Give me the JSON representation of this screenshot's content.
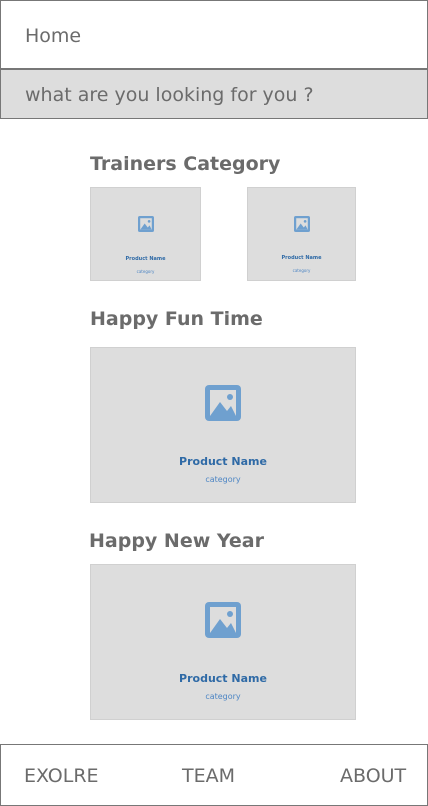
{
  "header": {
    "title": "Home"
  },
  "search": {
    "placeholder": "what are you looking for you ?"
  },
  "sections": [
    {
      "title": "Trainers Category",
      "cards": [
        {
          "name": "Product Name",
          "category": "category",
          "icon": "image-placeholder-icon"
        },
        {
          "name": "Product Name",
          "category": "category",
          "icon": "image-placeholder-icon"
        }
      ]
    },
    {
      "title": "Happy Fun Time",
      "cards": [
        {
          "name": "Product Name",
          "category": "category",
          "icon": "image-placeholder-icon"
        }
      ]
    },
    {
      "title": "Happy New Year",
      "cards": [
        {
          "name": "Product Name",
          "category": "category",
          "icon": "image-placeholder-icon"
        }
      ]
    }
  ],
  "footer": {
    "items": [
      "EXOLRE",
      "TEAM",
      "ABOUT"
    ]
  },
  "colors": {
    "card_bg": "#dddddd",
    "accent": "#2f6aa6",
    "border": "#777777"
  }
}
